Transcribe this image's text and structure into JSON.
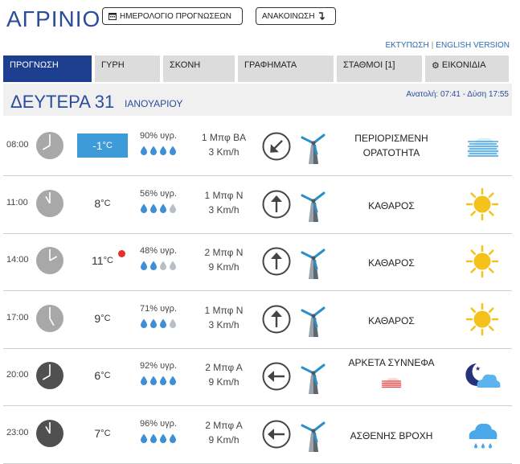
{
  "header": {
    "city": "ΑΓΡΙΝΙΟ",
    "calendar_button": "ΗΜΕΡΟΛΟΓΙΟ ΠΡΟΓΝΩΣΕΩΝ",
    "announcement_button": "ΑΝΑΚΟΙΝΩΣΗ",
    "print_link": "ΕΚΤΥΠΩΣΗ",
    "separator": "|",
    "english_link": "ENGLISH VERSION"
  },
  "tabs": [
    {
      "label": "ΠΡΟΓΝΩΣΗ",
      "active": true
    },
    {
      "label": "ΓΥΡΗ"
    },
    {
      "label": "ΣΚΟΝΗ"
    },
    {
      "label": "ΓΡΑΦΗΜΑΤΑ"
    },
    {
      "label": "ΣΤΑΘΜΟΙ  [1]"
    },
    {
      "label": "ΕΙΚΟΝΙΔΙΑ"
    }
  ],
  "day": {
    "name": "ΔΕΥΤΕΡΑ 31",
    "month": "ΙΑΝΟΥΑΡΙΟΥ",
    "sun_times": "Ανατολή: 07:41  - Δύση 17:55"
  },
  "colors": {
    "brand": "#2a4c9a",
    "active_tab": "#1e3f8f",
    "cold_box": "#3d9cd8",
    "drop": "#3d8fd6",
    "sun": "#f5c21b"
  },
  "rows": [
    {
      "time": "08:00",
      "temp": "-1",
      "unit": "°C",
      "cold": true,
      "hum": "90% υγρ.",
      "drops_filled": 4,
      "wind_bf": "1 Μπφ ΒΑ",
      "wind_kmh": "3 Km/h",
      "wind_dir_deg": 225,
      "cond1": "ΠΕΡΙΟΡΙΣΜΕΝΗ",
      "cond2": "ΟΡΑΤΟΤΗΤΑ",
      "icon": "fog-icon",
      "night_clock": false
    },
    {
      "time": "11:00",
      "temp": "8",
      "unit": "°C",
      "hum": "56% υγρ.",
      "drops_filled": 3,
      "wind_bf": "1 Μπφ Ν",
      "wind_kmh": "3 Km/h",
      "wind_dir_deg": 0,
      "cond1": "ΚΑΘΑΡΟΣ",
      "icon": "sun-icon",
      "night_clock": false
    },
    {
      "time": "14:00",
      "temp": "11",
      "unit": "°C",
      "max_dot": true,
      "hum": "48% υγρ.",
      "drops_filled": 2,
      "wind_bf": "2 Μπφ Ν",
      "wind_kmh": "9 Km/h",
      "wind_dir_deg": 0,
      "cond1": "ΚΑΘΑΡΟΣ",
      "icon": "sun-icon",
      "night_clock": false
    },
    {
      "time": "17:00",
      "temp": "9",
      "unit": "°C",
      "hum": "71% υγρ.",
      "drops_filled": 3,
      "wind_bf": "1 Μπφ Ν",
      "wind_kmh": "3 Km/h",
      "wind_dir_deg": 0,
      "cond1": "ΚΑΘΑΡΟΣ",
      "icon": "sun-icon",
      "night_clock": false
    },
    {
      "time": "20:00",
      "temp": "6",
      "unit": "°C",
      "hum": "92% υγρ.",
      "drops_filled": 4,
      "wind_bf": "2 Μπφ Α",
      "wind_kmh": "9 Km/h",
      "wind_dir_deg": 270,
      "cond1": "ΑΡΚΕΤΑ ΣΥΝΝΕΦΑ",
      "icon": "night-cloud-icon",
      "night_clock": true
    },
    {
      "time": "23:00",
      "temp": "7",
      "unit": "°C",
      "hum": "96% υγρ.",
      "drops_filled": 4,
      "wind_bf": "2 Μπφ Α",
      "wind_kmh": "9 Km/h",
      "wind_dir_deg": 270,
      "cond1": "ΑΣΘΕΝΗΣ ΒΡΟΧΗ",
      "icon": "rain-icon",
      "night_clock": true
    }
  ]
}
